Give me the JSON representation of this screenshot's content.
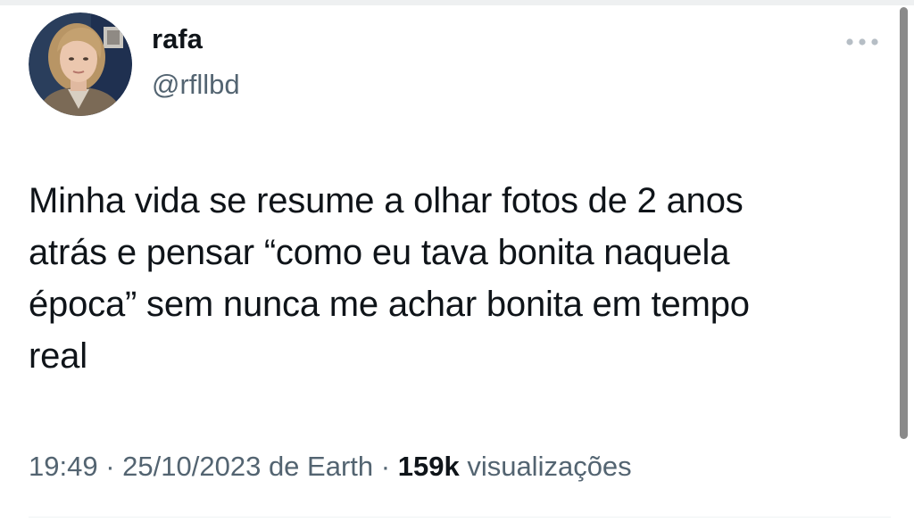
{
  "tweet": {
    "author": {
      "display_name": "rafa",
      "handle": "@rfllbd"
    },
    "text": "Minha vida se resume a olhar fotos de 2 anos\natrás e pensar “como eu tava bonita naquela\népoca” sem nunca me achar bonita em tempo\nreal",
    "time": "19:49",
    "separator": "·",
    "date": "25/10/2023",
    "source": "de Earth",
    "views_count": "159k",
    "views_label": "visualizações"
  },
  "icons": {
    "more": "more-horizontal-icon",
    "avatar": "profile-photo"
  },
  "colors": {
    "text_primary": "#0f1419",
    "text_secondary": "#536471",
    "scrollbar": "#8a8a8a",
    "background": "#ffffff"
  }
}
